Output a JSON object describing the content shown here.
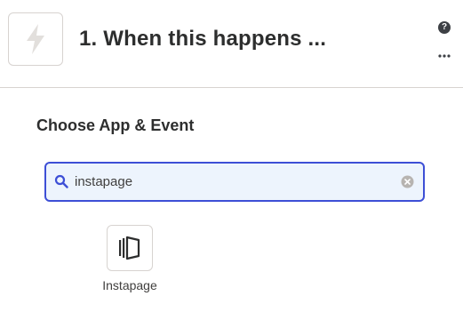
{
  "step": {
    "title": "1. When this happens ...",
    "trigger_icon": "bolt-icon",
    "help_label": "?"
  },
  "section": {
    "title": "Choose App & Event"
  },
  "search": {
    "value": "instapage",
    "icon": "search-icon",
    "clear_icon": "clear-icon"
  },
  "results": [
    {
      "label": "Instapage",
      "icon": "instapage-logo-icon"
    }
  ],
  "colors": {
    "accent": "#3d4fd6",
    "search_bg": "#edf4fd",
    "text": "#2d2e2e",
    "border": "#d7d3d0"
  }
}
